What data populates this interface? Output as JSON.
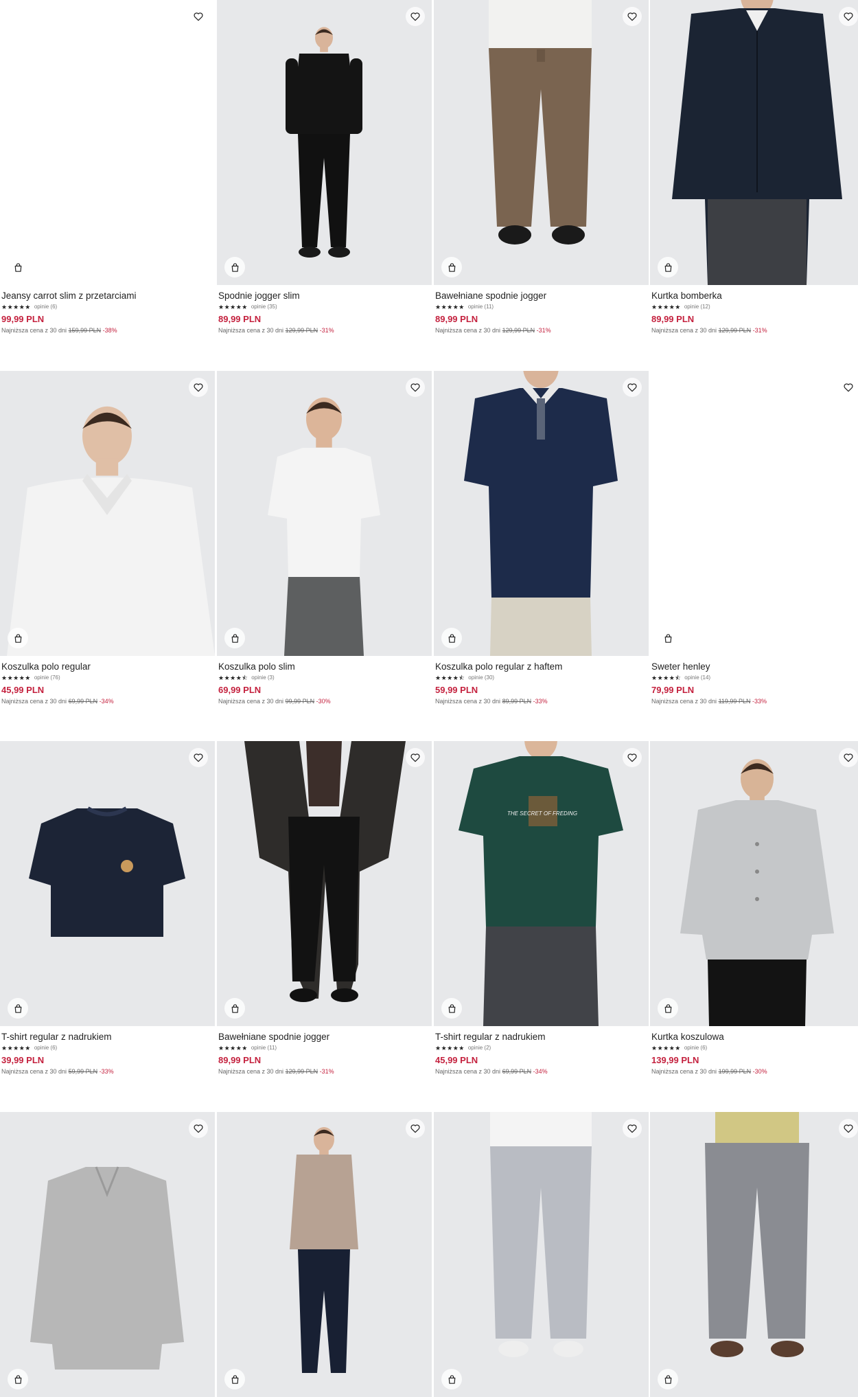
{
  "products": [
    {
      "name": "Jeansy carrot slim z przetarciami",
      "stars": "★★★★★",
      "reviews": "opinie (6)",
      "price": "99,99 PLN",
      "lowest_prefix": "Najniższa cena z 30 dni",
      "old_price": "159,99 PLN",
      "discount": "-38%"
    },
    {
      "name": "Spodnie jogger slim",
      "stars": "★★★★★",
      "reviews": "opinie (35)",
      "price": "89,99 PLN",
      "lowest_prefix": "Najniższa cena z 30 dni",
      "old_price": "129,99 PLN",
      "discount": "-31%"
    },
    {
      "name": "Bawełniane spodnie jogger",
      "stars": "★★★★★",
      "reviews": "opinie (11)",
      "price": "89,99 PLN",
      "lowest_prefix": "Najniższa cena z 30 dni",
      "old_price": "129,99 PLN",
      "discount": "-31%"
    },
    {
      "name": "Kurtka bomberka",
      "stars": "★★★★★",
      "reviews": "opinie (12)",
      "price": "89,99 PLN",
      "lowest_prefix": "Najniższa cena z 30 dni",
      "old_price": "129,99 PLN",
      "discount": "-31%"
    },
    {
      "name": "Koszulka polo regular",
      "stars": "★★★★★",
      "reviews": "opinie (76)",
      "price": "45,99 PLN",
      "lowest_prefix": "Najniższa cena z 30 dni",
      "old_price": "69,99 PLN",
      "discount": "-34%"
    },
    {
      "name": "Koszulka polo slim",
      "stars": "★★★★⯪",
      "reviews": "opinie (3)",
      "price": "69,99 PLN",
      "lowest_prefix": "Najniższa cena z 30 dni",
      "old_price": "99,99 PLN",
      "discount": "-30%"
    },
    {
      "name": "Koszulka polo regular z haftem",
      "stars": "★★★★⯪",
      "reviews": "opinie (30)",
      "price": "59,99 PLN",
      "lowest_prefix": "Najniższa cena z 30 dni",
      "old_price": "89,99 PLN",
      "discount": "-33%"
    },
    {
      "name": "Sweter henley",
      "stars": "★★★★⯪",
      "reviews": "opinie (14)",
      "price": "79,99 PLN",
      "lowest_prefix": "Najniższa cena z 30 dni",
      "old_price": "119,99 PLN",
      "discount": "-33%"
    },
    {
      "name": "T-shirt regular z nadrukiem",
      "stars": "★★★★★",
      "reviews": "opinie (6)",
      "price": "39,99 PLN",
      "lowest_prefix": "Najniższa cena z 30 dni",
      "old_price": "59,99 PLN",
      "discount": "-33%"
    },
    {
      "name": "Bawełniane spodnie jogger",
      "stars": "★★★★★",
      "reviews": "opinie (11)",
      "price": "89,99 PLN",
      "lowest_prefix": "Najniższa cena z 30 dni",
      "old_price": "129,99 PLN",
      "discount": "-31%"
    },
    {
      "name": "T-shirt regular z nadrukiem",
      "stars": "★★★★★",
      "reviews": "opinie (2)",
      "price": "45,99 PLN",
      "lowest_prefix": "Najniższa cena z 30 dni",
      "old_price": "69,99 PLN",
      "discount": "-34%"
    },
    {
      "name": "Kurtka koszulowa",
      "stars": "★★★★★",
      "reviews": "opinie (6)",
      "price": "139,99 PLN",
      "lowest_prefix": "Najniższa cena z 30 dni",
      "old_price": "199,99 PLN",
      "discount": "-30%"
    },
    {},
    {},
    {},
    {}
  ],
  "print_text": "THE SECRET OF FREDING",
  "icons": {
    "wishlist": "heart-icon",
    "cart": "shopping-bag-icon"
  },
  "colors": {
    "price": "#c4213e",
    "discount": "#c4213e",
    "text": "#222222",
    "photo_bg": "#e7e8ea"
  }
}
